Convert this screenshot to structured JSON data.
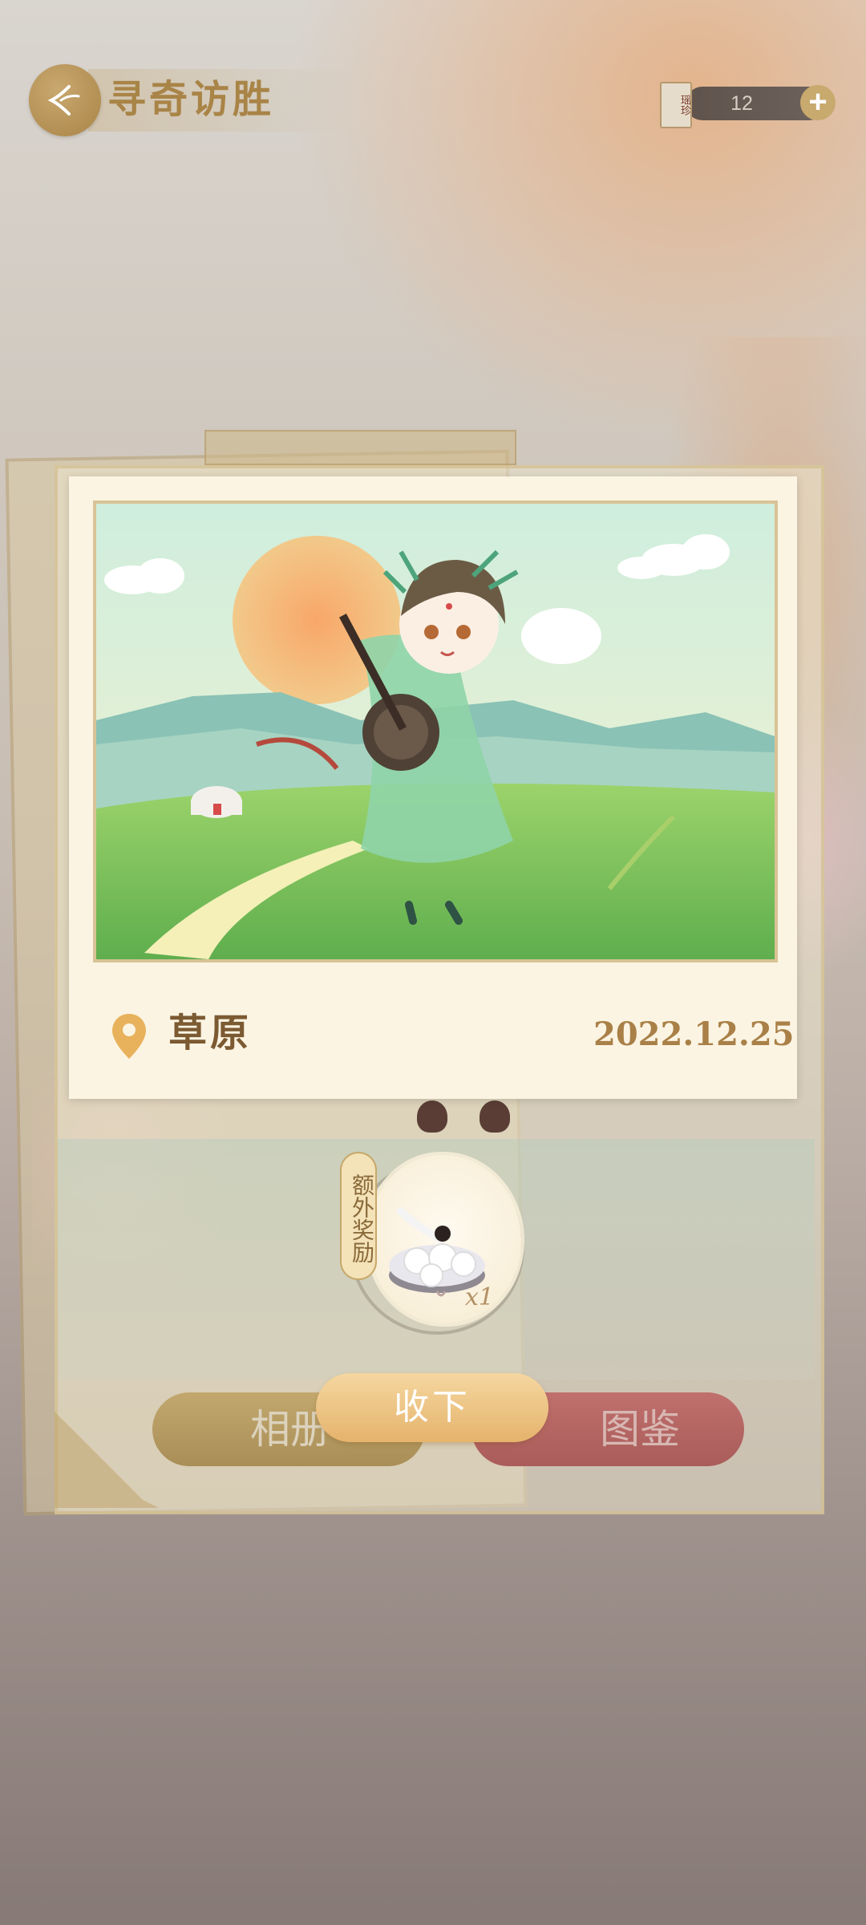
{
  "header": {
    "title": "寻奇访胜",
    "currency": {
      "icon_label": "瑶珍",
      "count": "12",
      "add_symbol": "+"
    }
  },
  "photo_card": {
    "location": "草原",
    "date": "2022.12.25"
  },
  "reward": {
    "tag": "额外奖励",
    "quantity": "x1",
    "item_icon": "tangyuan-bowl-icon"
  },
  "buttons": {
    "album": "相册",
    "codex": "图鉴",
    "accept": "收下"
  },
  "colors": {
    "gold": "#a98447",
    "accept": "#e5b36c",
    "codex": "#a95c5a",
    "card": "#fbf4e3"
  }
}
